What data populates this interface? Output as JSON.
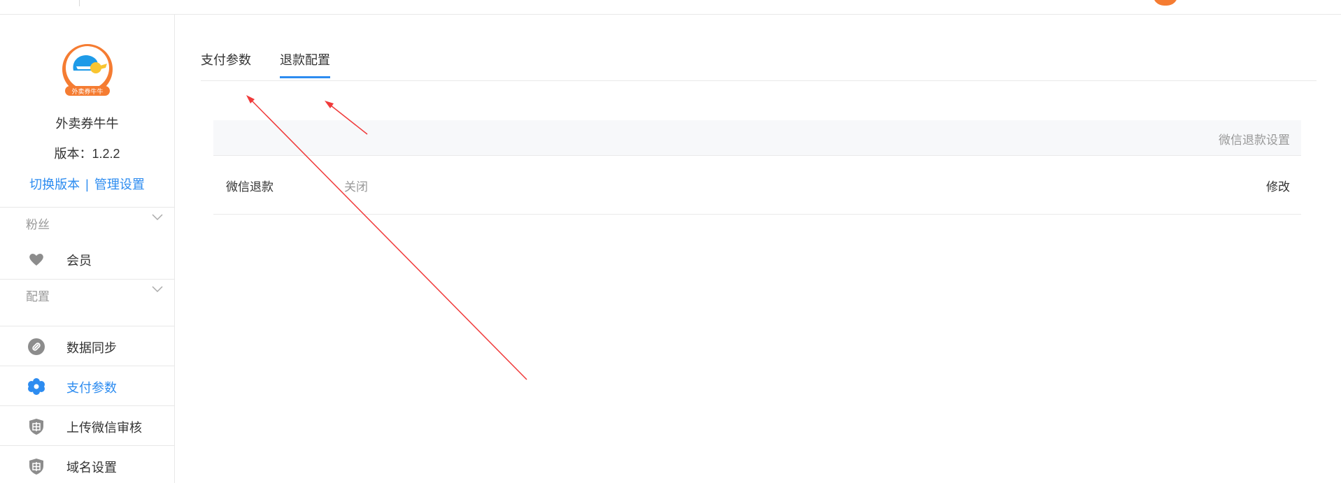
{
  "app": {
    "name": "外卖券牛牛",
    "version": "版本：1.2.2",
    "logo_caption": "外卖券牛牛",
    "switch_version": "切换版本",
    "separator": "|",
    "manage_settings": "管理设置"
  },
  "sidebar": {
    "groups": [
      {
        "label": "粉丝",
        "items": [
          {
            "label": "会员",
            "icon": "heart-icon"
          }
        ]
      },
      {
        "label": "配置",
        "items": [
          {
            "label": "数据同步",
            "icon": "link-icon"
          },
          {
            "label": "支付参数",
            "icon": "flower-gear-icon",
            "active": true
          },
          {
            "label": "上传微信审核",
            "icon": "shield-review-icon"
          },
          {
            "label": "域名设置",
            "icon": "shield-review-icon"
          }
        ]
      }
    ]
  },
  "tabs": [
    {
      "label": "支付参数",
      "active": false
    },
    {
      "label": "退款配置",
      "active": true
    }
  ],
  "refund_panel": {
    "title": "微信退款设置",
    "rows": [
      {
        "key": "微信退款",
        "value": "关闭",
        "action": "修改"
      }
    ]
  },
  "colors": {
    "accent": "#2d8cf0",
    "logo_orange": "#f57c32",
    "annotation_red": "#f03a3a"
  }
}
